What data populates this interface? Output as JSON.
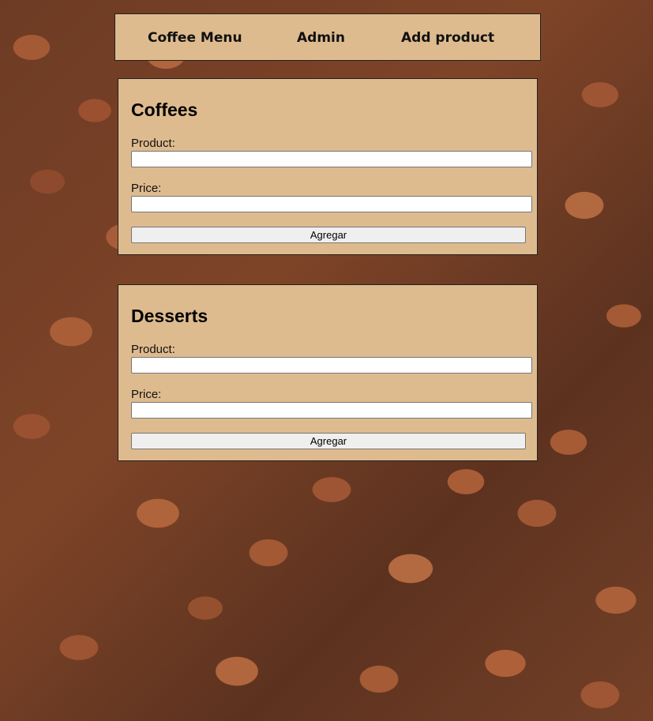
{
  "nav": {
    "items": [
      {
        "label": "Coffee Menu"
      },
      {
        "label": "Admin"
      },
      {
        "label": "Add product"
      }
    ]
  },
  "forms": {
    "coffees": {
      "title": "Coffees",
      "product_label": "Product:",
      "product_value": "",
      "price_label": "Price:",
      "price_value": "",
      "submit_label": "Agregar"
    },
    "desserts": {
      "title": "Desserts",
      "product_label": "Product:",
      "product_value": "",
      "price_label": "Price:",
      "price_value": "",
      "submit_label": "Agregar"
    }
  },
  "colors": {
    "panel_bg": "#debb8e",
    "border": "#222222",
    "button_bg": "#efefef"
  }
}
